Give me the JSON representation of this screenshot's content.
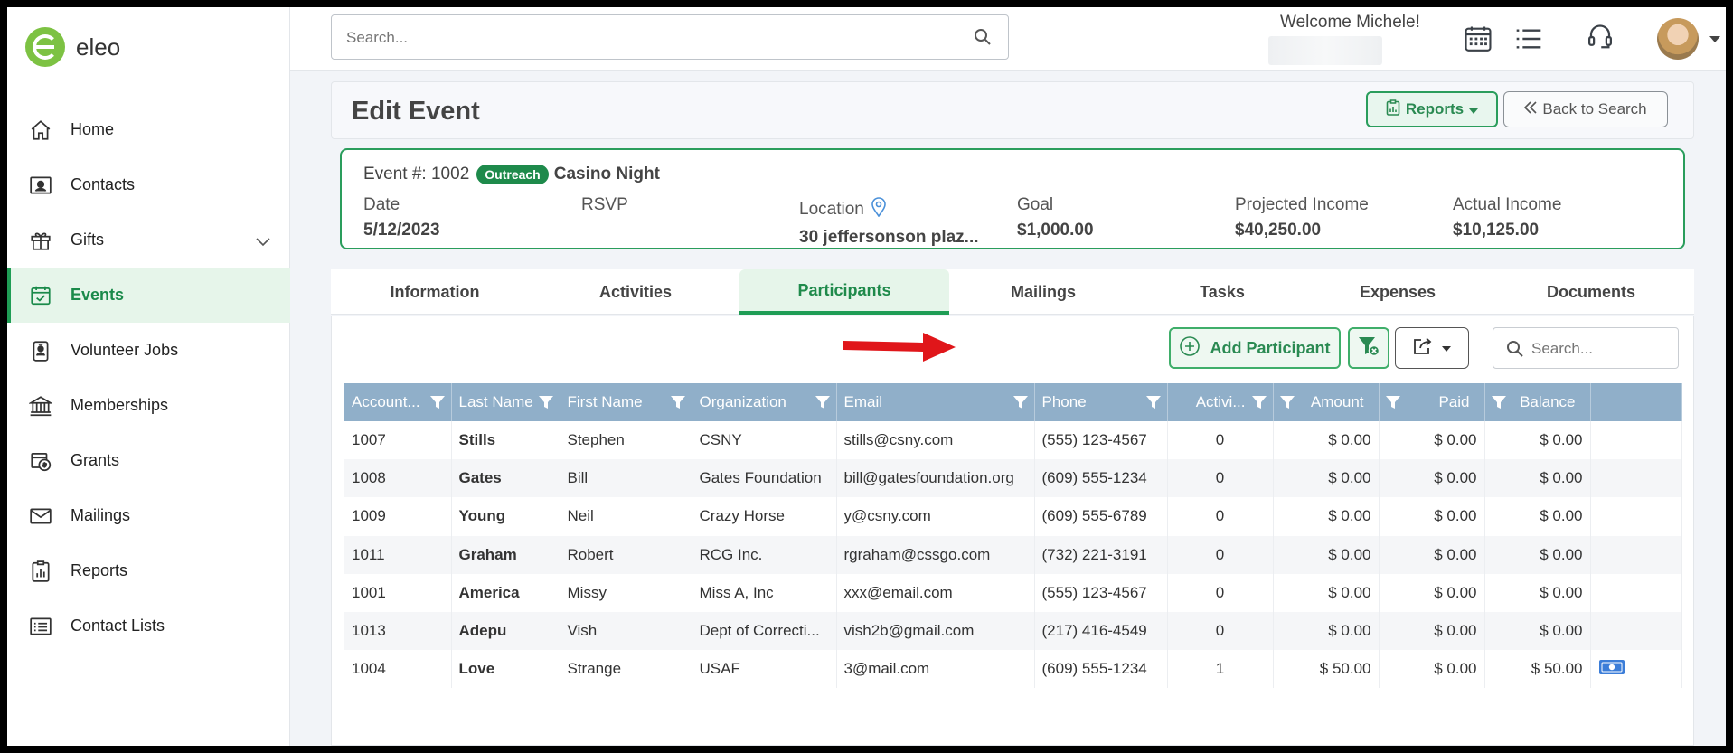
{
  "app": {
    "name": "eleo",
    "brand_color": "#7dc243",
    "accent_color": "#1f9d55"
  },
  "sidebar": {
    "items": [
      {
        "label": "Home",
        "icon": "home-icon"
      },
      {
        "label": "Contacts",
        "icon": "contact-card-icon"
      },
      {
        "label": "Gifts",
        "icon": "gift-icon"
      },
      {
        "label": "Events",
        "icon": "calendar-check-icon",
        "active": true
      },
      {
        "label": "Volunteer Jobs",
        "icon": "badge-icon"
      },
      {
        "label": "Memberships",
        "icon": "bank-icon"
      },
      {
        "label": "Grants",
        "icon": "grant-icon"
      },
      {
        "label": "Mailings",
        "icon": "envelope-icon"
      },
      {
        "label": "Reports",
        "icon": "report-icon"
      },
      {
        "label": "Contact Lists",
        "icon": "list-icon"
      }
    ]
  },
  "topbar": {
    "search_placeholder": "Search...",
    "welcome": "Welcome Michele!"
  },
  "header": {
    "title": "Edit Event",
    "reports_label": "Reports",
    "back_label": "Back to Search"
  },
  "event": {
    "number_label": "Event #: 1002",
    "badge": "Outreach",
    "name": "Casino Night",
    "date_label": "Date",
    "date_value": "5/12/2023",
    "rsvp_label": "RSVP",
    "location_label": "Location",
    "location_value": "30 jeffersonson plaz...",
    "goal_label": "Goal",
    "goal_value": "$1,000.00",
    "projected_label": "Projected Income",
    "projected_value": "$40,250.00",
    "actual_label": "Actual Income",
    "actual_value": "$10,125.00"
  },
  "tabs": [
    {
      "label": "Information"
    },
    {
      "label": "Activities"
    },
    {
      "label": "Participants",
      "active": true
    },
    {
      "label": "Mailings"
    },
    {
      "label": "Tasks"
    },
    {
      "label": "Expenses"
    },
    {
      "label": "Documents"
    }
  ],
  "participants": {
    "add_label": "Add Participant",
    "search_placeholder": "Search...",
    "columns": [
      "Account...",
      "Last Name",
      "First Name",
      "Organization",
      "Email",
      "Phone",
      "Activi...",
      "Amount",
      "Paid",
      "Balance"
    ],
    "rows": [
      [
        "1007",
        "Stills",
        "Stephen",
        "CSNY",
        "stills@csny.com",
        "(555) 123-4567",
        "0",
        "$ 0.00",
        "$ 0.00",
        "$ 0.00"
      ],
      [
        "1008",
        "Gates",
        "Bill",
        "Gates Foundation",
        "bill@gatesfoundation.org",
        "(609) 555-1234",
        "0",
        "$ 0.00",
        "$ 0.00",
        "$ 0.00"
      ],
      [
        "1009",
        "Young",
        "Neil",
        "Crazy Horse",
        "y@csny.com",
        "(609) 555-6789",
        "0",
        "$ 0.00",
        "$ 0.00",
        "$ 0.00"
      ],
      [
        "1011",
        "Graham",
        "Robert",
        "RCG Inc.",
        "rgraham@cssgo.com",
        "(732) 221-3191",
        "0",
        "$ 0.00",
        "$ 0.00",
        "$ 0.00"
      ],
      [
        "1001",
        "America",
        "Missy",
        "Miss A, Inc",
        "xxx@email.com",
        "(555) 123-4567",
        "0",
        "$ 0.00",
        "$ 0.00",
        "$ 0.00"
      ],
      [
        "1013",
        "Adepu",
        "Vish",
        "Dept of Correcti...",
        "vish2b@gmail.com",
        "(217) 416-4549",
        "0",
        "$ 0.00",
        "$ 0.00",
        "$ 0.00"
      ],
      [
        "1004",
        "Love",
        "Strange",
        "USAF",
        "3@mail.com",
        "(609) 555-1234",
        "1",
        "$ 50.00",
        "$ 0.00",
        "$ 50.00"
      ]
    ]
  }
}
